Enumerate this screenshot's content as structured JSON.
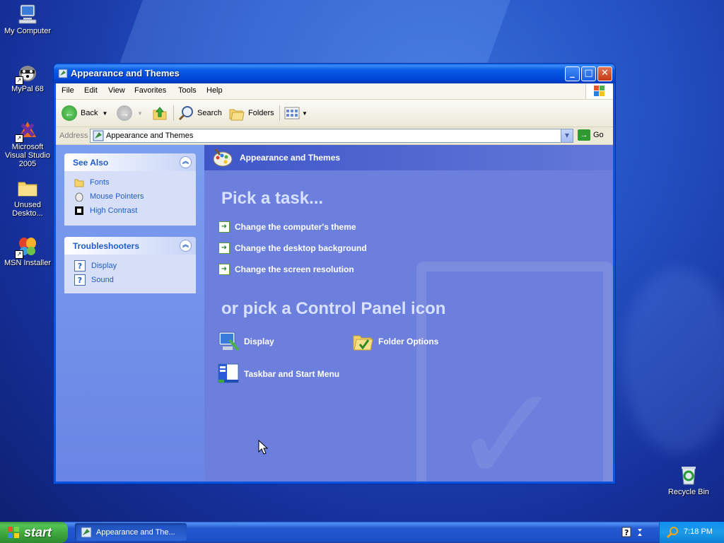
{
  "desktop": {
    "icons": [
      {
        "label": "My Computer"
      },
      {
        "label": "MyPal 68"
      },
      {
        "label": "Microsoft Visual Studio 2005"
      },
      {
        "label": "Unused Deskto..."
      },
      {
        "label": "MSN Installer"
      },
      {
        "label": "Recycle Bin"
      }
    ]
  },
  "window": {
    "title": "Appearance and Themes",
    "buttons": {
      "minimize": "_",
      "maximize": "□",
      "close": "✕"
    },
    "menu": [
      "File",
      "Edit",
      "View",
      "Favorites",
      "Tools",
      "Help"
    ],
    "toolbar": {
      "back": "Back",
      "search": "Search",
      "folders": "Folders"
    },
    "address": {
      "label": "Address",
      "value": "Appearance and Themes",
      "go": "Go"
    },
    "left_pane": {
      "see_also": {
        "title": "See Also",
        "items": [
          "Fonts",
          "Mouse Pointers",
          "High Contrast"
        ]
      },
      "troubleshooters": {
        "title": "Troubleshooters",
        "items": [
          "Display",
          "Sound"
        ]
      }
    },
    "right_pane": {
      "header": "Appearance and Themes",
      "pick_task": "Pick a task...",
      "tasks": [
        "Change the computer's theme",
        "Change the desktop background",
        "Change the screen resolution"
      ],
      "pick_icon": "or pick a Control Panel icon",
      "icons": [
        "Display",
        "Folder Options",
        "Taskbar and Start Menu"
      ]
    }
  },
  "taskbar": {
    "start": "start",
    "items": [
      "Appearance and The..."
    ],
    "clock": "7:18 PM"
  },
  "colors": {
    "xp_blue": "#0a53e0",
    "task_pane_link": "#215dc6",
    "content_blue": "#6c7fdc",
    "start_green": "#3ca53c"
  }
}
